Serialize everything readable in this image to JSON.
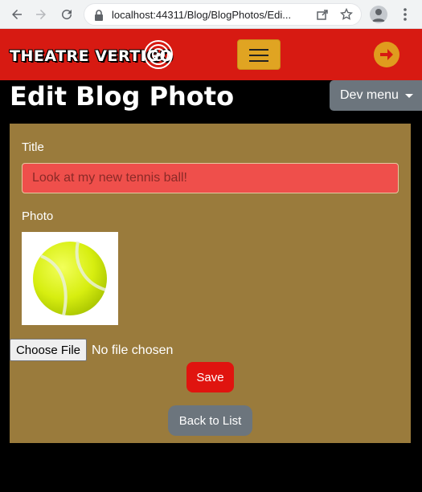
{
  "browser": {
    "url": "localhost:44311/Blog/BlogPhotos/Edi...",
    "back_icon": "arrow-left-icon",
    "forward_icon": "arrow-right-icon",
    "reload_icon": "reload-icon"
  },
  "header": {
    "logo_text": "THEATRE VERTIGO",
    "brand_color": "#d71a12",
    "accent_color": "#e0a422"
  },
  "page": {
    "title": "Edit Blog Photo",
    "dev_menu_label": "Dev menu"
  },
  "form": {
    "title_label": "Title",
    "title_value": "Look at my new tennis ball!",
    "photo_label": "Photo",
    "choose_file_label": "Choose File",
    "no_file_text": "No file chosen",
    "save_label": "Save",
    "back_label": "Back to List"
  }
}
